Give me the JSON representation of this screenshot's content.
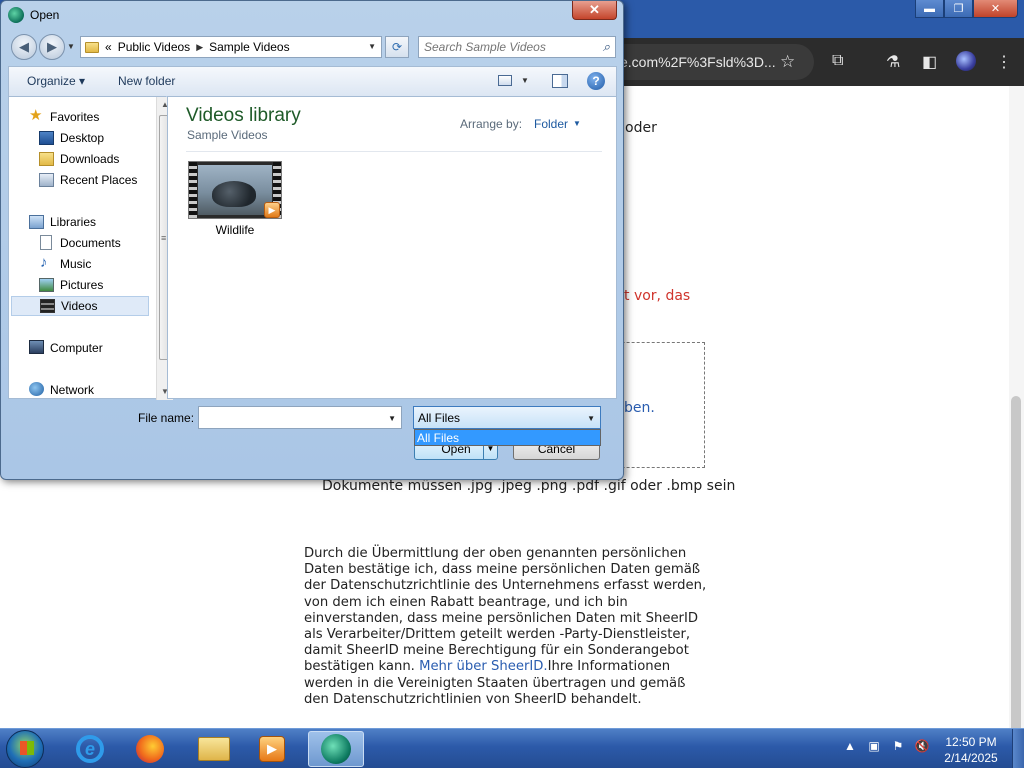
{
  "browser": {
    "address_text": "e.com%2F%3Fsld%3D...",
    "tab_text": "",
    "window_controls": {
      "minimize": "▬",
      "restore": "❐",
      "close": "✕"
    }
  },
  "page": {
    "line_oder": "oder",
    "line_red": "t vor, das",
    "line_blue": "ben.",
    "formats_note": "Dokumente müssen .jpg .jpeg .png .pdf .gif oder .bmp sein",
    "consent_text": "Durch die Übermittlung der oben genannten persönlichen Daten bestätige ich, dass meine persönlichen Daten gemäß der Datenschutzrichtlinie des Unternehmens erfasst werden, von dem ich einen Rabatt beantrage, und ich bin einverstanden, dass meine persönlichen Daten mit SheerID als Verarbeiter/Drittem geteilt werden -Party-Dienstleister, damit SheerID meine Berechtigung für ein Sonderangebot bestätigen kann. ",
    "consent_link": "Mehr über SheerID.",
    "consent_tail": "Ihre Informationen werden in die Vereinigten Staaten übertragen und gemäß den Datenschutzrichtlinien von SheerID behandelt."
  },
  "dialog": {
    "title": "Open",
    "close_label": "✕",
    "path": {
      "prefix": "«",
      "crumbs": [
        "Public Videos",
        "Sample Videos"
      ]
    },
    "search_placeholder": "Search Sample Videos",
    "toolbar": {
      "organize": "Organize ▾",
      "new_folder": "New folder"
    },
    "nav": {
      "favorites": "Favorites",
      "desktop": "Desktop",
      "downloads": "Downloads",
      "recent_places": "Recent Places",
      "libraries": "Libraries",
      "documents": "Documents",
      "music": "Music",
      "pictures": "Pictures",
      "videos": "Videos",
      "computer": "Computer",
      "network": "Network"
    },
    "library": {
      "title": "Videos library",
      "subtitle": "Sample Videos",
      "arrange_label": "Arrange by:",
      "arrange_value": "Folder"
    },
    "files": [
      {
        "name": "Wildlife",
        "type": "video"
      }
    ],
    "file_name_label": "File name:",
    "file_name_value": "",
    "filter_value": "All Files",
    "filter_options": [
      "All Files"
    ],
    "open_button": "Open",
    "cancel_button": "Cancel"
  },
  "taskbar": {
    "time": "12:50 PM",
    "date": "2/14/2025",
    "apps": [
      "internet-explorer",
      "firefox",
      "windows-explorer",
      "media-player",
      "active-app"
    ]
  },
  "colors": {
    "taskbar": "#2c5aa9",
    "selection": "#3399ff",
    "library_title": "#1e5a28",
    "link": "#2a5db0"
  }
}
